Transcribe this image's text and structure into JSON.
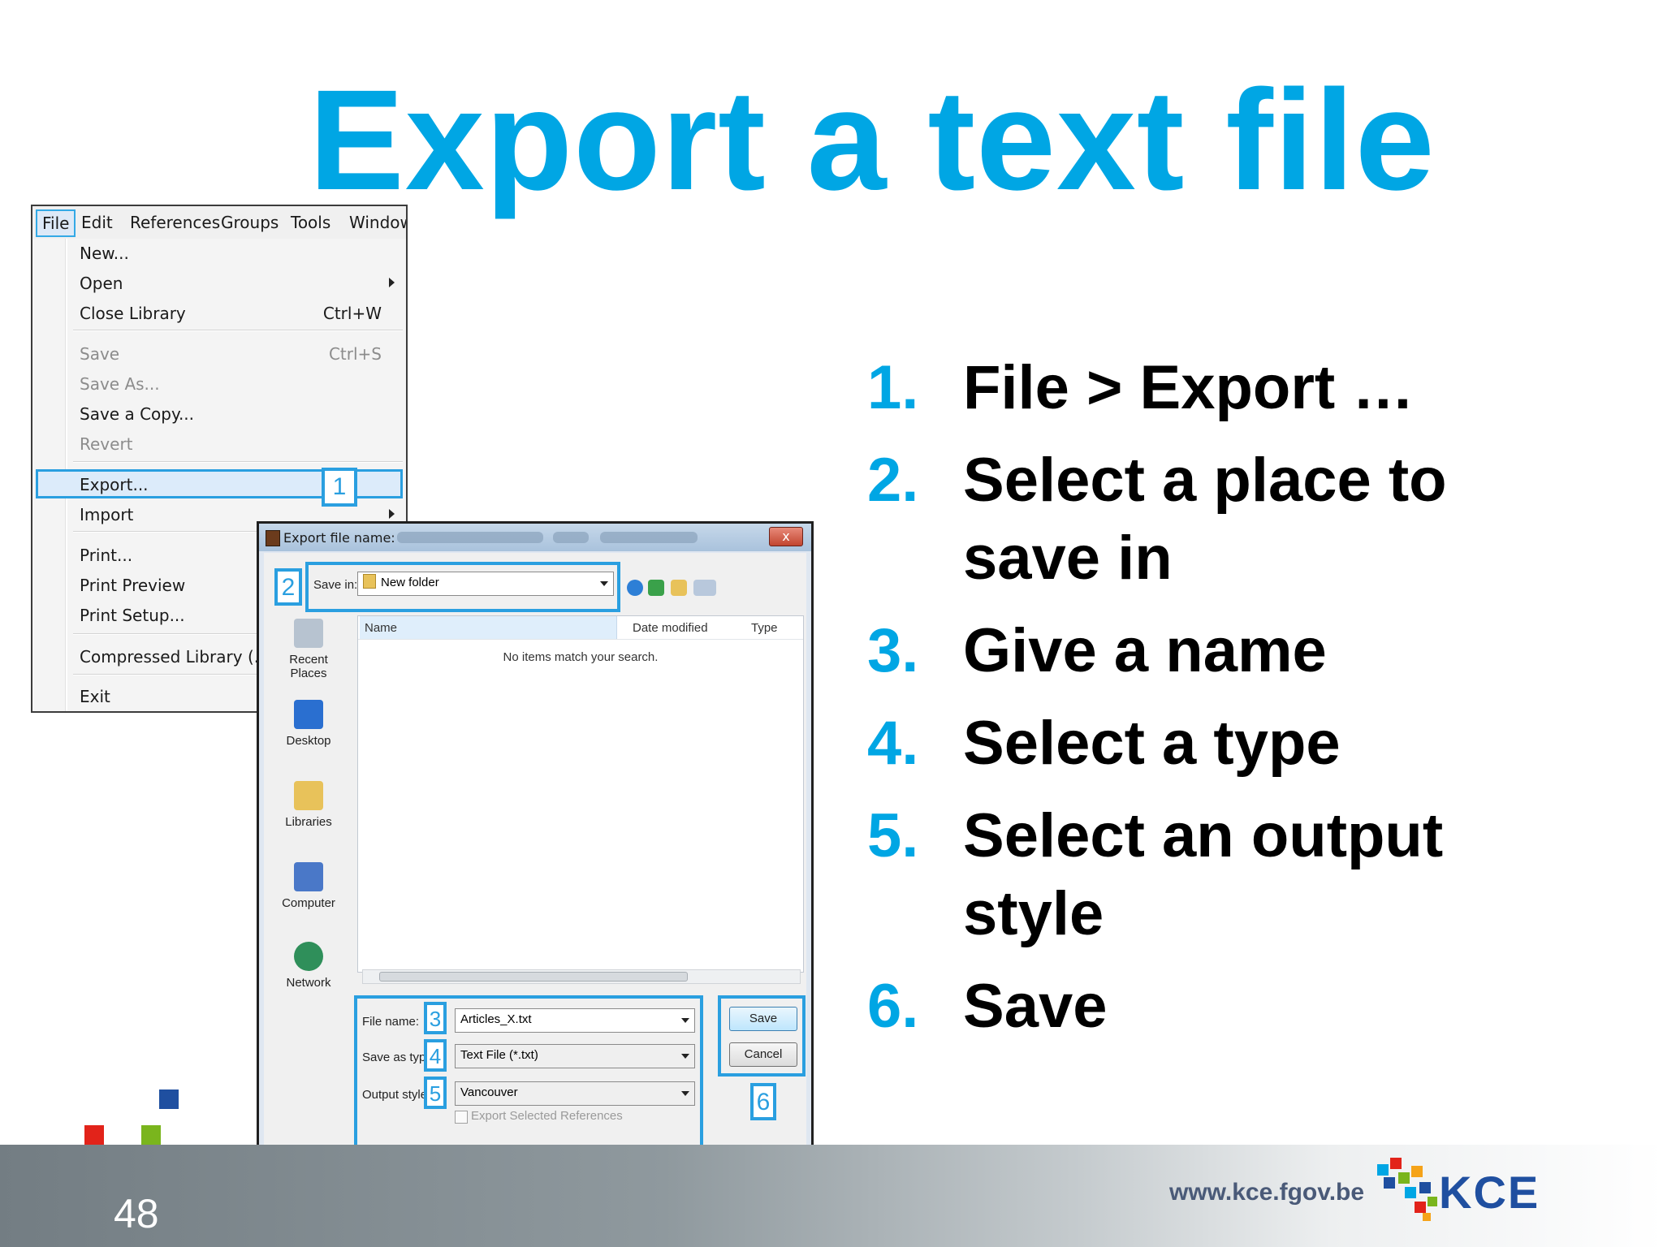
{
  "slide": {
    "title": "Export a text file",
    "page_number": "48",
    "footer_url": "www.kce.fgov.be",
    "logo_text": "KCE"
  },
  "steps": [
    {
      "num": "1.",
      "text": "File > Export …"
    },
    {
      "num": "2.",
      "text": "Select a place to save in"
    },
    {
      "num": "3.",
      "text": "Give a name"
    },
    {
      "num": "4.",
      "text": "Select a type"
    },
    {
      "num": "5.",
      "text": "Select an output style"
    },
    {
      "num": "6.",
      "text": "Save"
    }
  ],
  "menu": {
    "bar": [
      "File",
      "Edit",
      "References",
      "Groups",
      "Tools",
      "Window"
    ],
    "items": {
      "new": "New...",
      "open": "Open",
      "close_library": "Close Library",
      "close_library_shortcut": "Ctrl+W",
      "save": "Save",
      "save_shortcut": "Ctrl+S",
      "save_as": "Save As...",
      "save_a_copy": "Save a Copy...",
      "revert": "Revert",
      "export": "Export...",
      "import": "Import",
      "print": "Print...",
      "print_preview": "Print Preview",
      "print_setup": "Print Setup...",
      "compressed_library": "Compressed Library (.enl",
      "exit": "Exit"
    }
  },
  "callouts": [
    "1",
    "2",
    "3",
    "4",
    "5",
    "6"
  ],
  "dialog": {
    "title": "Export file name:",
    "close": "x",
    "save_in_label": "Save in:",
    "save_in_value": "New folder",
    "places": [
      "Recent Places",
      "Desktop",
      "Libraries",
      "Computer",
      "Network"
    ],
    "columns": [
      "Name",
      "Date modified",
      "Type"
    ],
    "empty_message": "No items match your search.",
    "file_name_label": "File name:",
    "file_name_value": "Articles_X.txt",
    "save_as_type_label": "Save as type:",
    "save_as_type_value": "Text File (*.txt)",
    "output_style_label": "Output style:",
    "output_style_value": "Vancouver",
    "export_selected_label": "Export Selected References",
    "save_button": "Save",
    "cancel_button": "Cancel"
  },
  "colors": {
    "accent": "#00a6e4",
    "callout": "#2a9fe0",
    "logo_blue": "#1f4fa0",
    "logo_red": "#e2231a",
    "logo_green": "#7ab51d",
    "logo_orange": "#f5a319"
  }
}
